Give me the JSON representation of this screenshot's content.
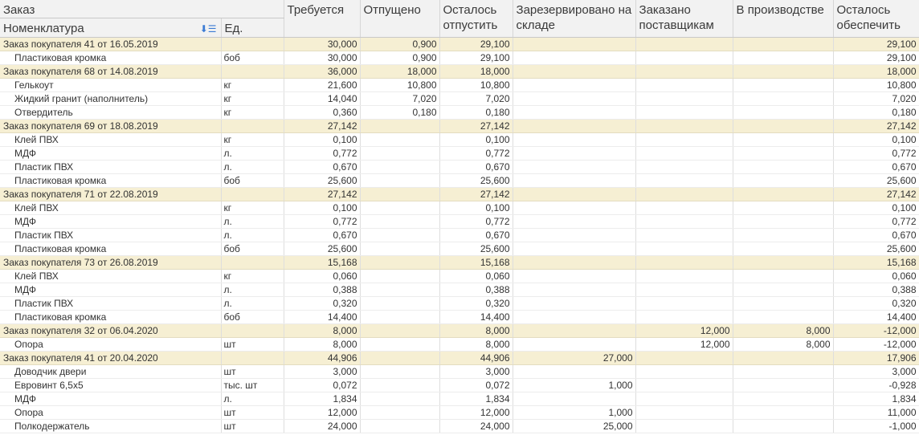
{
  "header": {
    "col_order": "Заказ",
    "col_nomenclature": "Номенклатура",
    "col_unit": "Ед.",
    "col_required": "Требуется",
    "col_released": "Отпущено",
    "col_remaining_release": "Осталось отпустить",
    "col_reserved": "Зарезервировано на складе",
    "col_ordered_suppliers": "Заказано поставщикам",
    "col_in_production": "В производстве",
    "col_remaining_provide": "Осталось обеспечить"
  },
  "rows": [
    {
      "type": "group",
      "name": "Заказ покупателя 41 от 16.05.2019",
      "unit": "",
      "req": "30,000",
      "rel": "0,900",
      "rem": "29,100",
      "res": "",
      "ord": "",
      "prod": "",
      "prov": "29,100"
    },
    {
      "type": "item",
      "name": "Пластиковая кромка",
      "unit": "боб",
      "req": "30,000",
      "rel": "0,900",
      "rem": "29,100",
      "res": "",
      "ord": "",
      "prod": "",
      "prov": "29,100"
    },
    {
      "type": "group",
      "name": "Заказ покупателя 68 от 14.08.2019",
      "unit": "",
      "req": "36,000",
      "rel": "18,000",
      "rem": "18,000",
      "res": "",
      "ord": "",
      "prod": "",
      "prov": "18,000"
    },
    {
      "type": "item",
      "name": "Гелькоут",
      "unit": "кг",
      "req": "21,600",
      "rel": "10,800",
      "rem": "10,800",
      "res": "",
      "ord": "",
      "prod": "",
      "prov": "10,800"
    },
    {
      "type": "item",
      "name": "Жидкий гранит (наполнитель)",
      "unit": "кг",
      "req": "14,040",
      "rel": "7,020",
      "rem": "7,020",
      "res": "",
      "ord": "",
      "prod": "",
      "prov": "7,020"
    },
    {
      "type": "item",
      "name": "Отвердитель",
      "unit": "кг",
      "req": "0,360",
      "rel": "0,180",
      "rem": "0,180",
      "res": "",
      "ord": "",
      "prod": "",
      "prov": "0,180"
    },
    {
      "type": "group",
      "name": "Заказ покупателя 69 от 18.08.2019",
      "unit": "",
      "req": "27,142",
      "rel": "",
      "rem": "27,142",
      "res": "",
      "ord": "",
      "prod": "",
      "prov": "27,142"
    },
    {
      "type": "item",
      "name": "Клей ПВХ",
      "unit": "кг",
      "req": "0,100",
      "rel": "",
      "rem": "0,100",
      "res": "",
      "ord": "",
      "prod": "",
      "prov": "0,100"
    },
    {
      "type": "item",
      "name": "МДФ",
      "unit": "л.",
      "req": "0,772",
      "rel": "",
      "rem": "0,772",
      "res": "",
      "ord": "",
      "prod": "",
      "prov": "0,772"
    },
    {
      "type": "item",
      "name": "Пластик ПВХ",
      "unit": "л.",
      "req": "0,670",
      "rel": "",
      "rem": "0,670",
      "res": "",
      "ord": "",
      "prod": "",
      "prov": "0,670"
    },
    {
      "type": "item",
      "name": "Пластиковая кромка",
      "unit": "боб",
      "req": "25,600",
      "rel": "",
      "rem": "25,600",
      "res": "",
      "ord": "",
      "prod": "",
      "prov": "25,600"
    },
    {
      "type": "group",
      "name": "Заказ покупателя 71 от 22.08.2019",
      "unit": "",
      "req": "27,142",
      "rel": "",
      "rem": "27,142",
      "res": "",
      "ord": "",
      "prod": "",
      "prov": "27,142"
    },
    {
      "type": "item",
      "name": "Клей ПВХ",
      "unit": "кг",
      "req": "0,100",
      "rel": "",
      "rem": "0,100",
      "res": "",
      "ord": "",
      "prod": "",
      "prov": "0,100"
    },
    {
      "type": "item",
      "name": "МДФ",
      "unit": "л.",
      "req": "0,772",
      "rel": "",
      "rem": "0,772",
      "res": "",
      "ord": "",
      "prod": "",
      "prov": "0,772"
    },
    {
      "type": "item",
      "name": "Пластик ПВХ",
      "unit": "л.",
      "req": "0,670",
      "rel": "",
      "rem": "0,670",
      "res": "",
      "ord": "",
      "prod": "",
      "prov": "0,670"
    },
    {
      "type": "item",
      "name": "Пластиковая кромка",
      "unit": "боб",
      "req": "25,600",
      "rel": "",
      "rem": "25,600",
      "res": "",
      "ord": "",
      "prod": "",
      "prov": "25,600"
    },
    {
      "type": "group",
      "name": "Заказ покупателя 73 от 26.08.2019",
      "unit": "",
      "req": "15,168",
      "rel": "",
      "rem": "15,168",
      "res": "",
      "ord": "",
      "prod": "",
      "prov": "15,168"
    },
    {
      "type": "item",
      "name": "Клей ПВХ",
      "unit": "кг",
      "req": "0,060",
      "rel": "",
      "rem": "0,060",
      "res": "",
      "ord": "",
      "prod": "",
      "prov": "0,060"
    },
    {
      "type": "item",
      "name": "МДФ",
      "unit": "л.",
      "req": "0,388",
      "rel": "",
      "rem": "0,388",
      "res": "",
      "ord": "",
      "prod": "",
      "prov": "0,388"
    },
    {
      "type": "item",
      "name": "Пластик ПВХ",
      "unit": "л.",
      "req": "0,320",
      "rel": "",
      "rem": "0,320",
      "res": "",
      "ord": "",
      "prod": "",
      "prov": "0,320"
    },
    {
      "type": "item",
      "name": "Пластиковая кромка",
      "unit": "боб",
      "req": "14,400",
      "rel": "",
      "rem": "14,400",
      "res": "",
      "ord": "",
      "prod": "",
      "prov": "14,400"
    },
    {
      "type": "group",
      "name": "Заказ покупателя 32 от 06.04.2020",
      "unit": "",
      "req": "8,000",
      "rel": "",
      "rem": "8,000",
      "res": "",
      "ord": "12,000",
      "prod": "8,000",
      "prov": "-12,000"
    },
    {
      "type": "item",
      "name": "Опора",
      "unit": "шт",
      "req": "8,000",
      "rel": "",
      "rem": "8,000",
      "res": "",
      "ord": "12,000",
      "prod": "8,000",
      "prov": "-12,000"
    },
    {
      "type": "group",
      "name": "Заказ покупателя 41 от 20.04.2020",
      "unit": "",
      "req": "44,906",
      "rel": "",
      "rem": "44,906",
      "res": "27,000",
      "ord": "",
      "prod": "",
      "prov": "17,906"
    },
    {
      "type": "item",
      "name": "Доводчик двери",
      "unit": "шт",
      "req": "3,000",
      "rel": "",
      "rem": "3,000",
      "res": "",
      "ord": "",
      "prod": "",
      "prov": "3,000"
    },
    {
      "type": "item",
      "name": "Евровинт 6,5х5",
      "unit": "тыс. шт",
      "req": "0,072",
      "rel": "",
      "rem": "0,072",
      "res": "1,000",
      "ord": "",
      "prod": "",
      "prov": "-0,928"
    },
    {
      "type": "item",
      "name": "МДФ",
      "unit": "л.",
      "req": "1,834",
      "rel": "",
      "rem": "1,834",
      "res": "",
      "ord": "",
      "prod": "",
      "prov": "1,834"
    },
    {
      "type": "item",
      "name": "Опора",
      "unit": "шт",
      "req": "12,000",
      "rel": "",
      "rem": "12,000",
      "res": "1,000",
      "ord": "",
      "prod": "",
      "prov": "11,000"
    },
    {
      "type": "item",
      "name": "Полкодержатель",
      "unit": "шт",
      "req": "24,000",
      "rel": "",
      "rem": "24,000",
      "res": "25,000",
      "ord": "",
      "prod": "",
      "prov": "-1,000"
    }
  ]
}
